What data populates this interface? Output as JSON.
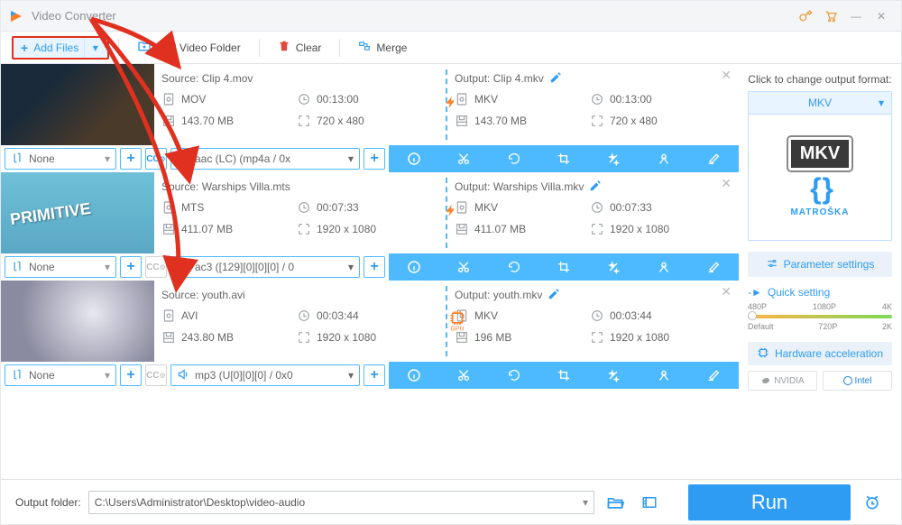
{
  "app": {
    "title": "Video Converter"
  },
  "titlebar_icons": {
    "key": "key-icon",
    "cart": "cart-icon",
    "min": "minimize",
    "close": "close"
  },
  "toolbar": {
    "add_files": "Add Files",
    "add_folder": "Add Video Folder",
    "clear": "Clear",
    "merge": "Merge"
  },
  "items": [
    {
      "thumb_class": "t1",
      "src": {
        "label": "Source: Clip 4.mov",
        "fmt": "MOV",
        "dur": "00:13:00",
        "size": "143.70 MB",
        "res": "720 x 480",
        "indicator": "bolt"
      },
      "out": {
        "label": "Output: Clip 4.mkv",
        "fmt": "MKV",
        "dur": "00:13:00",
        "size": "143.70 MB",
        "res": "720 x 480"
      },
      "sub": "None",
      "cc_on": true,
      "audio": "aac (LC) (mp4a / 0x"
    },
    {
      "thumb_class": "t2",
      "src": {
        "label": "Source: Warships Villa.mts",
        "fmt": "MTS",
        "dur": "00:07:33",
        "size": "411.07 MB",
        "res": "1920 x 1080",
        "indicator": "bolt"
      },
      "out": {
        "label": "Output: Warships Villa.mkv",
        "fmt": "MKV",
        "dur": "00:07:33",
        "size": "411.07 MB",
        "res": "1920 x 1080"
      },
      "sub": "None",
      "cc_on": false,
      "audio": "ac3 ([129][0][0][0] / 0"
    },
    {
      "thumb_class": "t3",
      "src": {
        "label": "Source: youth.avi",
        "fmt": "AVI",
        "dur": "00:03:44",
        "size": "243.80 MB",
        "res": "1920 x 1080",
        "indicator": "gpu"
      },
      "out": {
        "label": "Output: youth.mkv",
        "fmt": "MKV",
        "dur": "00:03:44",
        "size": "196 MB",
        "res": "1920 x 1080"
      },
      "sub": "None",
      "cc_on": false,
      "audio": "mp3 (U[0][0][0] / 0x0"
    }
  ],
  "side": {
    "prompt": "Click to change output format:",
    "fmt": "MKV",
    "badge": "MKV",
    "brand": "MATROŠKA",
    "param": "Parameter settings",
    "quick": "Quick setting",
    "marks_top": [
      "480P",
      "1080P",
      "4K"
    ],
    "marks_bot": [
      "Default",
      "720P",
      "2K"
    ],
    "hw": "Hardware acceleration",
    "nv": "NVIDIA",
    "intel": "Intel"
  },
  "footer": {
    "label": "Output folder:",
    "path": "C:\\Users\\Administrator\\Desktop\\video-audio",
    "run": "Run"
  }
}
